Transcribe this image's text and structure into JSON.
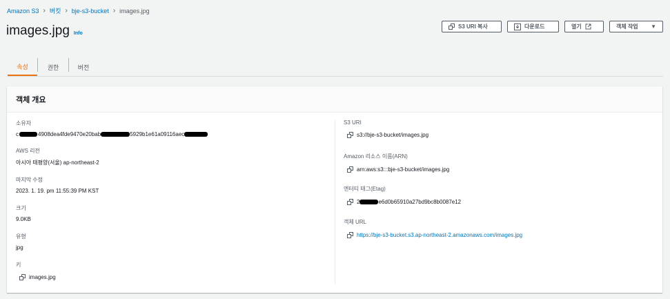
{
  "breadcrumb": {
    "service": "Amazon S3",
    "buckets": "버킷",
    "bucket": "bje-s3-bucket",
    "object": "images.jpg"
  },
  "header": {
    "title": "images.jpg",
    "info": "Info"
  },
  "actions": {
    "copy_uri": "S3 URI 복사",
    "download": "다운로드",
    "open": "열기",
    "object_actions": "객체 작업"
  },
  "tabs": [
    "속성",
    "권한",
    "버전"
  ],
  "overview": {
    "title": "객체 개요",
    "owner": {
      "label": "소유자",
      "value_start": "c",
      "value_part1": "4908dea4fde9470e20bab",
      "value_part2": "5929b1e61a09116aec"
    },
    "region": {
      "label": "AWS 리전",
      "value": "아시아 태평양(서울) ap-northeast-2"
    },
    "modified": {
      "label": "마지막 수정",
      "value": "2023. 1. 19. pm 11:55:39 PM KST"
    },
    "size": {
      "label": "크기",
      "value": "9.0KB"
    },
    "type": {
      "label": "유형",
      "value": "jpg"
    },
    "key": {
      "label": "키",
      "value": "images.jpg"
    },
    "s3_uri": {
      "label": "S3 URI",
      "value": "s3://bje-s3-bucket/images.jpg"
    },
    "arn": {
      "label": "Amazon 리소스 이름(ARN)",
      "value": "arn:aws:s3:::bje-s3-bucket/images.jpg"
    },
    "etag": {
      "label": "엔터티 태그(Etag)",
      "value_start": "2",
      "value_end": "e6d0b65910a27bd9bc8b0087e12"
    },
    "url": {
      "label": "객체 URL",
      "value": "https://bje-s3-bucket.s3.ap-northeast-2.amazonaws.com/images.jpg"
    }
  }
}
